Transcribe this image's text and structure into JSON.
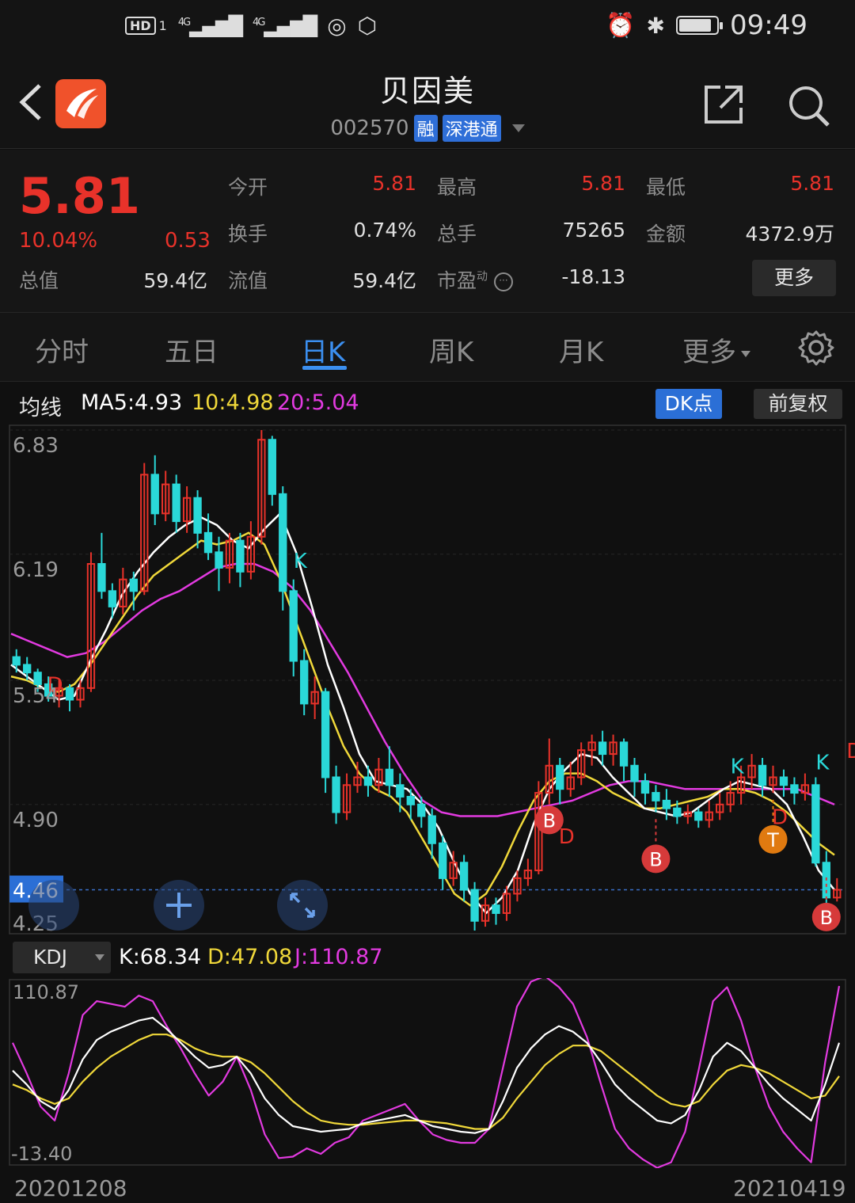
{
  "status_bar": {
    "hd": "HD",
    "sim": "1",
    "net1": "4G",
    "net2": "4G",
    "time": "09:49"
  },
  "header": {
    "name": "贝因美",
    "code": "002570",
    "tag_margin": "融",
    "tag_connect": "深港通"
  },
  "quote": {
    "price": "5.81",
    "change_pct": "10.04%",
    "change": "0.53",
    "total_value_label": "总值",
    "total_value": "59.4亿",
    "open_label": "今开",
    "open": "5.81",
    "high_label": "最高",
    "high": "5.81",
    "low_label": "最低",
    "low": "5.81",
    "turnover_label": "换手",
    "turnover": "0.74%",
    "volume_label": "总手",
    "volume": "75265",
    "amount_label": "金额",
    "amount": "4372.9万",
    "float_label": "流值",
    "float_value": "59.4亿",
    "pe_label": "市盈",
    "pe_sup": "动",
    "pe": "-18.13",
    "more": "更多"
  },
  "tabs": {
    "intraday": "分时",
    "five_day": "五日",
    "day_k": "日K",
    "week_k": "周K",
    "month_k": "月K",
    "more": "更多"
  },
  "ma_bar": {
    "label": "均线",
    "ma5": "MA5:4.93",
    "ma10": "10:4.98",
    "ma20": "20:5.04",
    "dk": "DK点",
    "adjust": "前复权"
  },
  "colors": {
    "up": "#e8322a",
    "down": "#2ad8d8",
    "ma5": "#ffffff",
    "ma10": "#f0d83a",
    "ma20": "#e23ae0",
    "accent": "#3b8ff0"
  },
  "price_axis": {
    "top": "6.83",
    "l2": "6.19",
    "l3": "5.54",
    "l4": "4.90",
    "bottom": "4.25",
    "current": "4.46"
  },
  "kdj": {
    "selector": "KDJ",
    "k": "K:68.34",
    "d": "D:47.08",
    "j": "J:110.87",
    "top": "110.87",
    "bottom": "-13.40"
  },
  "dates": {
    "start": "20201208",
    "end": "20210419"
  },
  "chart_data": {
    "type": "candlestick",
    "ylim": [
      4.25,
      6.83
    ],
    "candles": [
      [
        5.66,
        5.62,
        5.7,
        5.58
      ],
      [
        5.62,
        5.58,
        5.66,
        5.54
      ],
      [
        5.58,
        5.52,
        5.6,
        5.48
      ],
      [
        5.52,
        5.46,
        5.56,
        5.43
      ],
      [
        5.46,
        5.5,
        5.54,
        5.4
      ],
      [
        5.5,
        5.44,
        5.52,
        5.38
      ],
      [
        5.44,
        5.5,
        5.54,
        5.4
      ],
      [
        5.5,
        6.14,
        6.2,
        5.48
      ],
      [
        6.14,
        6.0,
        6.3,
        5.96
      ],
      [
        6.0,
        5.92,
        6.04,
        5.86
      ],
      [
        5.92,
        6.06,
        6.12,
        5.88
      ],
      [
        6.06,
        6.0,
        6.1,
        5.9
      ],
      [
        6.0,
        6.6,
        6.66,
        5.98
      ],
      [
        6.6,
        6.4,
        6.7,
        6.34
      ],
      [
        6.4,
        6.55,
        6.62,
        6.36
      ],
      [
        6.55,
        6.36,
        6.6,
        6.3
      ],
      [
        6.36,
        6.48,
        6.54,
        6.3
      ],
      [
        6.48,
        6.3,
        6.52,
        6.22
      ],
      [
        6.3,
        6.2,
        6.4,
        6.16
      ],
      [
        6.2,
        6.12,
        6.28,
        6.0
      ],
      [
        6.12,
        6.26,
        6.3,
        6.04
      ],
      [
        6.26,
        6.1,
        6.3,
        6.02
      ],
      [
        6.1,
        6.28,
        6.36,
        6.06
      ],
      [
        6.28,
        6.78,
        6.83,
        6.24
      ],
      [
        6.78,
        6.5,
        6.8,
        6.44
      ],
      [
        6.5,
        6.0,
        6.54,
        5.9
      ],
      [
        6.0,
        5.64,
        6.06,
        5.56
      ],
      [
        5.64,
        5.42,
        5.7,
        5.36
      ],
      [
        5.42,
        5.48,
        5.56,
        5.34
      ],
      [
        5.48,
        5.04,
        5.5,
        4.96
      ],
      [
        5.04,
        4.86,
        5.1,
        4.8
      ],
      [
        4.86,
        5.0,
        5.06,
        4.82
      ],
      [
        5.0,
        5.04,
        5.12,
        4.96
      ],
      [
        5.04,
        5.0,
        5.1,
        4.94
      ],
      [
        5.0,
        5.08,
        5.14,
        4.96
      ],
      [
        5.08,
        5.0,
        5.2,
        4.94
      ],
      [
        5.0,
        4.94,
        5.06,
        4.86
      ],
      [
        4.94,
        4.9,
        4.98,
        4.82
      ],
      [
        4.9,
        4.84,
        4.94,
        4.78
      ],
      [
        4.84,
        4.7,
        4.88,
        4.62
      ],
      [
        4.7,
        4.52,
        4.74,
        4.46
      ],
      [
        4.52,
        4.6,
        4.66,
        4.48
      ],
      [
        4.6,
        4.46,
        4.64,
        4.4
      ],
      [
        4.46,
        4.3,
        4.5,
        4.25
      ],
      [
        4.3,
        4.38,
        4.42,
        4.27
      ],
      [
        4.38,
        4.34,
        4.42,
        4.28
      ],
      [
        4.34,
        4.44,
        4.48,
        4.3
      ],
      [
        4.44,
        4.52,
        4.56,
        4.4
      ],
      [
        4.52,
        4.56,
        4.62,
        4.48
      ],
      [
        4.56,
        4.96,
        5.02,
        4.54
      ],
      [
        4.96,
        5.1,
        5.24,
        4.9
      ],
      [
        5.1,
        4.98,
        5.14,
        4.9
      ],
      [
        4.98,
        5.04,
        5.12,
        4.94
      ],
      [
        5.04,
        5.18,
        5.22,
        5.0
      ],
      [
        5.18,
        5.22,
        5.26,
        5.1
      ],
      [
        5.22,
        5.16,
        5.28,
        5.1
      ],
      [
        5.16,
        5.22,
        5.26,
        5.1
      ],
      [
        5.22,
        5.1,
        5.24,
        5.02
      ],
      [
        5.1,
        5.02,
        5.14,
        4.94
      ],
      [
        5.02,
        4.96,
        5.06,
        4.9
      ],
      [
        4.96,
        4.92,
        5.0,
        4.86
      ],
      [
        4.92,
        4.88,
        4.98,
        4.82
      ],
      [
        4.88,
        4.84,
        4.92,
        4.8
      ],
      [
        4.84,
        4.86,
        4.9,
        4.8
      ],
      [
        4.86,
        4.82,
        4.88,
        4.78
      ],
      [
        4.82,
        4.86,
        4.92,
        4.78
      ],
      [
        4.86,
        4.9,
        4.96,
        4.82
      ],
      [
        4.9,
        4.96,
        5.02,
        4.86
      ],
      [
        4.96,
        5.04,
        5.1,
        4.9
      ],
      [
        5.04,
        5.1,
        5.16,
        4.98
      ],
      [
        5.1,
        5.0,
        5.14,
        4.94
      ],
      [
        5.0,
        5.04,
        5.1,
        4.96
      ],
      [
        5.04,
        5.0,
        5.08,
        4.94
      ],
      [
        5.0,
        4.96,
        5.04,
        4.9
      ],
      [
        4.96,
        5.0,
        5.06,
        4.92
      ],
      [
        5.0,
        4.6,
        5.04,
        4.58
      ],
      [
        4.6,
        4.42,
        4.66,
        4.38
      ],
      [
        4.42,
        4.46,
        4.52,
        4.4
      ]
    ],
    "ma5": [
      5.62,
      5.56,
      5.5,
      5.44,
      5.46,
      5.64,
      5.8,
      5.98,
      6.1,
      6.2,
      6.28,
      6.34,
      6.38,
      6.34,
      6.26,
      6.22,
      6.32,
      6.4,
      6.2,
      5.92,
      5.62,
      5.4,
      5.16,
      5.02,
      5.0,
      4.98,
      4.9,
      4.78,
      4.6,
      4.44,
      4.34,
      4.42,
      4.56,
      4.8,
      4.98,
      5.08,
      5.16,
      5.14,
      5.04,
      4.96,
      4.88,
      4.86,
      4.84,
      4.86,
      4.92,
      4.98,
      5.02,
      5.0,
      4.98,
      4.9,
      4.74,
      4.56,
      4.46
    ],
    "ma10": [
      5.56,
      5.54,
      5.5,
      5.48,
      5.52,
      5.62,
      5.74,
      5.86,
      5.98,
      6.08,
      6.14,
      6.2,
      6.26,
      6.24,
      6.26,
      6.3,
      6.24,
      6.06,
      5.84,
      5.62,
      5.4,
      5.2,
      5.06,
      4.98,
      4.94,
      4.86,
      4.72,
      4.58,
      4.44,
      4.38,
      4.44,
      4.58,
      4.76,
      4.92,
      5.02,
      5.06,
      5.06,
      5.02,
      4.96,
      4.92,
      4.88,
      4.88,
      4.9,
      4.92,
      4.94,
      4.98,
      4.98,
      4.96,
      4.92,
      4.86,
      4.78,
      4.7,
      4.64
    ],
    "ma20": [
      5.78,
      5.74,
      5.7,
      5.66,
      5.68,
      5.74,
      5.82,
      5.9,
      5.96,
      6.0,
      6.06,
      6.12,
      6.14,
      6.14,
      6.1,
      6.02,
      5.9,
      5.74,
      5.58,
      5.4,
      5.22,
      5.06,
      4.92,
      4.86,
      4.84,
      4.84,
      4.84,
      4.86,
      4.88,
      4.9,
      4.92,
      4.96,
      5.0,
      5.02,
      5.02,
      5.0,
      4.98,
      4.98,
      4.98,
      4.98,
      4.98,
      4.98,
      4.98,
      4.94,
      4.9
    ],
    "markers": [
      {
        "label": "D",
        "type": "d-signal"
      },
      {
        "label": "K",
        "type": "k-signal"
      },
      {
        "label": "B",
        "type": "buy"
      },
      {
        "label": "D",
        "type": "d-signal"
      },
      {
        "label": "B",
        "type": "buy"
      },
      {
        "label": "K",
        "type": "k-signal"
      },
      {
        "label": "D",
        "type": "d-signal"
      },
      {
        "label": "T",
        "type": "t-signal"
      },
      {
        "label": "K",
        "type": "k-signal"
      },
      {
        "label": "D",
        "type": "d-signal"
      },
      {
        "label": "B",
        "type": "buy"
      }
    ]
  },
  "kdj_data": {
    "ylim": [
      -13.4,
      110.87
    ],
    "k": [
      50,
      40,
      28,
      22,
      36,
      58,
      72,
      78,
      82,
      86,
      88,
      80,
      70,
      60,
      52,
      54,
      60,
      48,
      30,
      18,
      10,
      8,
      6,
      7,
      8,
      12,
      14,
      16,
      18,
      14,
      10,
      8,
      6,
      5,
      8,
      28,
      52,
      66,
      76,
      82,
      78,
      70,
      56,
      40,
      30,
      22,
      14,
      12,
      18,
      36,
      60,
      70,
      64,
      52,
      40,
      30,
      22,
      14,
      40,
      70
    ],
    "d": [
      40,
      36,
      30,
      26,
      30,
      42,
      52,
      60,
      66,
      72,
      76,
      76,
      72,
      66,
      62,
      60,
      60,
      56,
      48,
      38,
      28,
      20,
      14,
      12,
      11,
      11,
      12,
      13,
      14,
      14,
      13,
      12,
      10,
      8,
      8,
      16,
      30,
      42,
      54,
      62,
      68,
      68,
      64,
      56,
      48,
      40,
      32,
      26,
      24,
      28,
      40,
      50,
      54,
      52,
      48,
      42,
      36,
      30,
      32,
      46
    ],
    "j": [
      70,
      48,
      24,
      14,
      48,
      90,
      100,
      98,
      96,
      104,
      100,
      82,
      66,
      48,
      32,
      42,
      60,
      36,
      4,
      -13,
      -12,
      -6,
      -10,
      -2,
      2,
      14,
      18,
      22,
      26,
      14,
      4,
      0,
      -2,
      -2,
      8,
      52,
      96,
      114,
      118,
      110,
      98,
      74,
      40,
      8,
      -6,
      -14,
      -20,
      -16,
      6,
      52,
      100,
      110,
      86,
      52,
      24,
      6,
      -6,
      -16,
      56,
      110.87
    ]
  }
}
